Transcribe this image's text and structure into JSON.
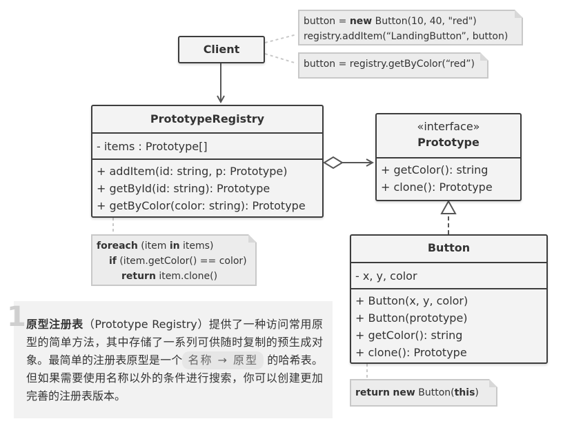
{
  "client": {
    "title": "Client"
  },
  "notes": {
    "client_top": {
      "line1": {
        "a": "button = ",
        "kw": "new",
        "b": " Button(10, 40, \"red\")"
      },
      "line2": "registry.addItem(“LandingButton”, button)"
    },
    "client_bottom": {
      "line1": "button = registry.getByColor(“red”)"
    },
    "registry": {
      "line1": {
        "kw1": "foreach",
        "a": " (item ",
        "kw2": "in",
        "b": " items)"
      },
      "line2": {
        "kw": "if",
        "a": " (item.getColor() == color)"
      },
      "line3": {
        "kw": "return",
        "a": " item.clone()"
      }
    },
    "button": {
      "kw1": "return",
      "kw2": "new",
      "a": " Button(",
      "kw3": "this",
      "b": ")"
    }
  },
  "registry": {
    "title": "PrototypeRegistry",
    "fields": [
      "- items : Prototype[]"
    ],
    "methods": [
      "+ addItem(id: string, p: Prototype)",
      "+ getById(id: string): Prototype",
      "+ getByColor(color: string): Prototype"
    ]
  },
  "prototype": {
    "stereotype": "«interface»",
    "title": "Prototype",
    "methods": [
      "+ getColor(): string",
      "+ clone(): Prototype"
    ]
  },
  "button": {
    "title": "Button",
    "fields": [
      "- x, y, color"
    ],
    "methods": [
      "+ Button(x, y, color)",
      "+ Button(prototype)",
      "+ getColor(): string",
      "+ clone(): Prototype"
    ]
  },
  "caption": {
    "number": "1",
    "bold": "原型注册表",
    "text1": "（Prototype Registry）提供了一种访问常用原型的简单方法，其中存储了一系列可供随时复制的预生成对象。最简单的注册表原型是一个",
    "chip": "名称 → 原型",
    "text2": " 的哈希表。但如果需要使用名称以外的条件进行搜索，你可以创建更加完善的注册表版本。"
  },
  "colors": {
    "border": "#3c3c3c",
    "box_fill": "#f3f3f3",
    "note_fill": "#ececec"
  }
}
